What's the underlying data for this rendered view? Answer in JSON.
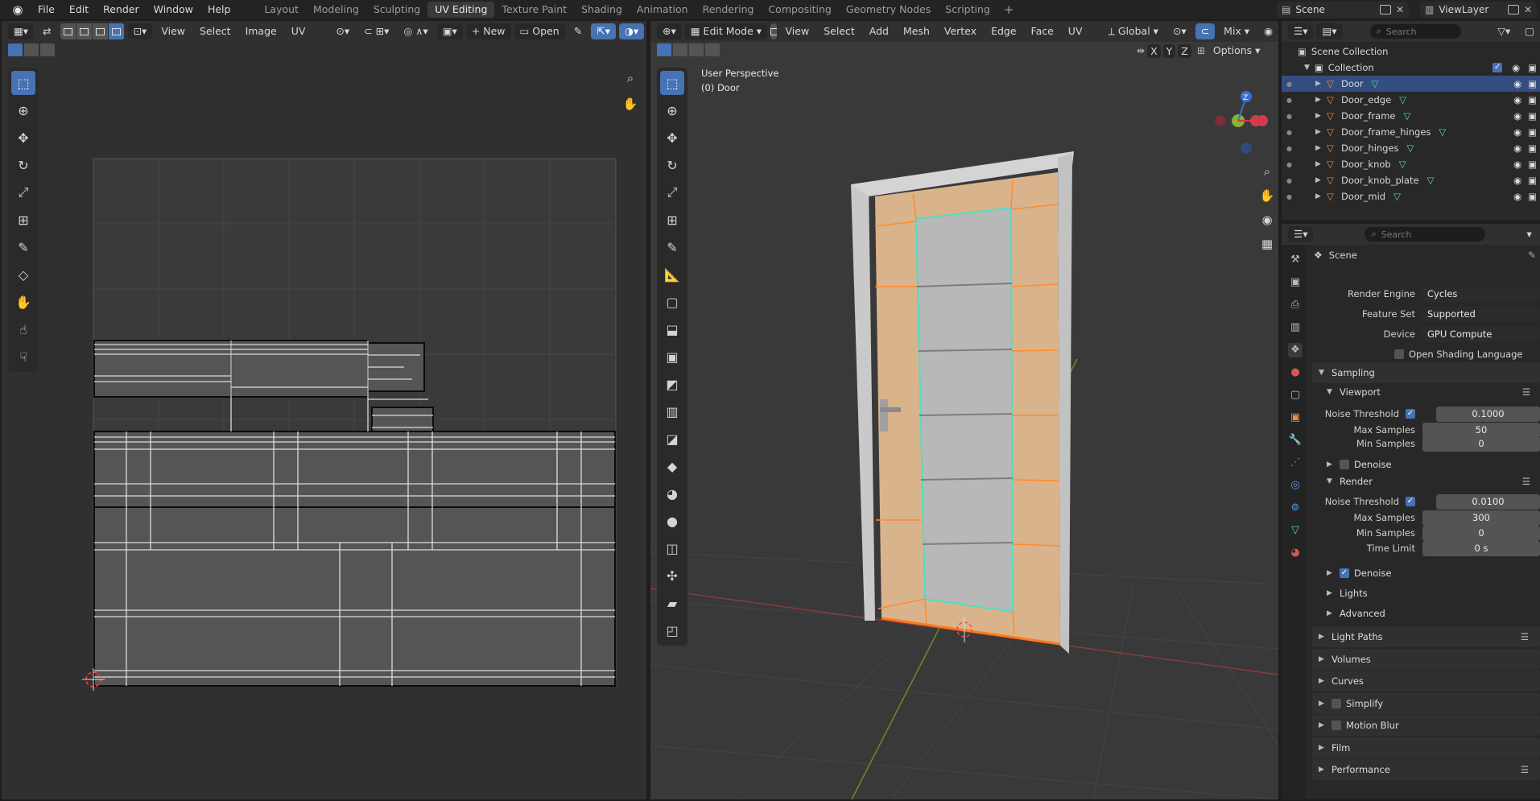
{
  "topbar": {
    "menus": [
      "File",
      "Edit",
      "Render",
      "Window",
      "Help"
    ],
    "workspaces": [
      "Layout",
      "Modeling",
      "Sculpting",
      "UV Editing",
      "Texture Paint",
      "Shading",
      "Animation",
      "Rendering",
      "Compositing",
      "Geometry Nodes",
      "Scripting"
    ],
    "active_workspace": "UV Editing",
    "scene_name": "Scene",
    "view_layer": "ViewLayer"
  },
  "uv_editor": {
    "menus": [
      "View",
      "Select",
      "Image",
      "UV"
    ],
    "new_label": "New",
    "open_label": "Open"
  },
  "viewport": {
    "mode": "Edit Mode",
    "menus": [
      "View",
      "Select",
      "Add",
      "Mesh",
      "Vertex",
      "Edge",
      "Face",
      "UV"
    ],
    "transform_orientation": "Global",
    "shading": "Mix",
    "options_label": "Options",
    "axes": [
      "X",
      "Y",
      "Z"
    ],
    "overlay_line1": "User Perspective",
    "overlay_line2": "(0) Door",
    "gizmo_z": "Z"
  },
  "outliner": {
    "search_placeholder": "Search",
    "scene_collection": "Scene Collection",
    "collection": "Collection",
    "objects": [
      {
        "name": "Door",
        "selected": true
      },
      {
        "name": "Door_edge",
        "selected": false
      },
      {
        "name": "Door_frame",
        "selected": false
      },
      {
        "name": "Door_frame_hinges",
        "selected": false
      },
      {
        "name": "Door_hinges",
        "selected": false
      },
      {
        "name": "Door_knob",
        "selected": false
      },
      {
        "name": "Door_knob_plate",
        "selected": false
      },
      {
        "name": "Door_mid",
        "selected": false
      }
    ]
  },
  "properties": {
    "search_placeholder": "Search",
    "context": "Scene",
    "render_engine_label": "Render Engine",
    "render_engine": "Cycles",
    "feature_set_label": "Feature Set",
    "feature_set": "Supported",
    "device_label": "Device",
    "device": "GPU Compute",
    "osl_label": "Open Shading Language",
    "sampling": "Sampling",
    "viewport": "Viewport",
    "render": "Render",
    "noise_threshold_label": "Noise Threshold",
    "vp_noise_threshold": "0.1000",
    "max_samples_label": "Max Samples",
    "vp_max_samples": "50",
    "min_samples_label": "Min Samples",
    "vp_min_samples": "0",
    "denoise_label": "Denoise",
    "r_noise_threshold": "0.0100",
    "r_max_samples": "300",
    "r_min_samples": "0",
    "time_limit_label": "Time Limit",
    "r_time_limit": "0 s",
    "lights": "Lights",
    "advanced": "Advanced",
    "panels": [
      "Light Paths",
      "Volumes",
      "Curves",
      "Simplify",
      "Motion Blur",
      "Film",
      "Performance"
    ]
  },
  "colors": {
    "accent": "#4772b3",
    "selected_row": "#334d80",
    "door_face": "#d9b38c",
    "edge_highlight": "#ff7a1a",
    "seam": "#4fe0c0"
  }
}
